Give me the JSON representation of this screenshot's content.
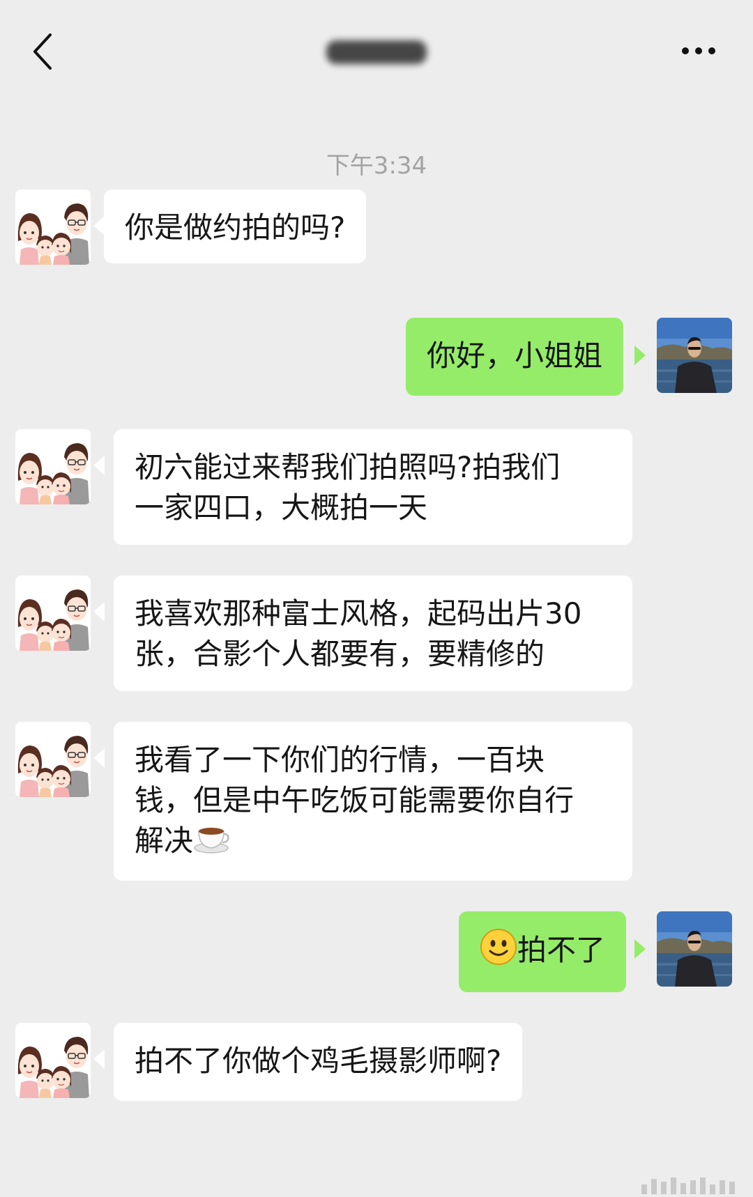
{
  "header": {
    "back_icon": "chevron-left-icon",
    "contact_name": "",
    "more_icon": "ellipsis-icon"
  },
  "timestamp": "下午3:34",
  "colors": {
    "background": "#ededed",
    "incoming_bubble": "#ffffff",
    "outgoing_bubble": "#95ec69",
    "timestamp_text": "#a3a3a3"
  },
  "messages": [
    {
      "direction": "incoming",
      "avatar": "family-cartoon-avatar",
      "text": "你是做约拍的吗?"
    },
    {
      "direction": "outgoing",
      "avatar": "user-photo-avatar",
      "text": "你好，小姐姐"
    },
    {
      "direction": "incoming",
      "avatar": "family-cartoon-avatar",
      "text": "初六能过来帮我们拍照吗?拍我们\n一家四口，大概拍一天"
    },
    {
      "direction": "incoming",
      "avatar": "family-cartoon-avatar",
      "text": "我喜欢那种富士风格，起码出片30\n张，合影个人都要有，要精修的"
    },
    {
      "direction": "incoming",
      "avatar": "family-cartoon-avatar",
      "text": "我看了一下你们的行情，一百块\n钱，但是中午吃饭可能需要你自行\n解决",
      "emoji": "coffee-cup-icon"
    },
    {
      "direction": "outgoing",
      "avatar": "user-photo-avatar",
      "emoji": "smile-emoji-icon",
      "text": "拍不了"
    },
    {
      "direction": "incoming",
      "avatar": "family-cartoon-avatar",
      "text": "拍不了你做个鸡毛摄影师啊?"
    }
  ]
}
